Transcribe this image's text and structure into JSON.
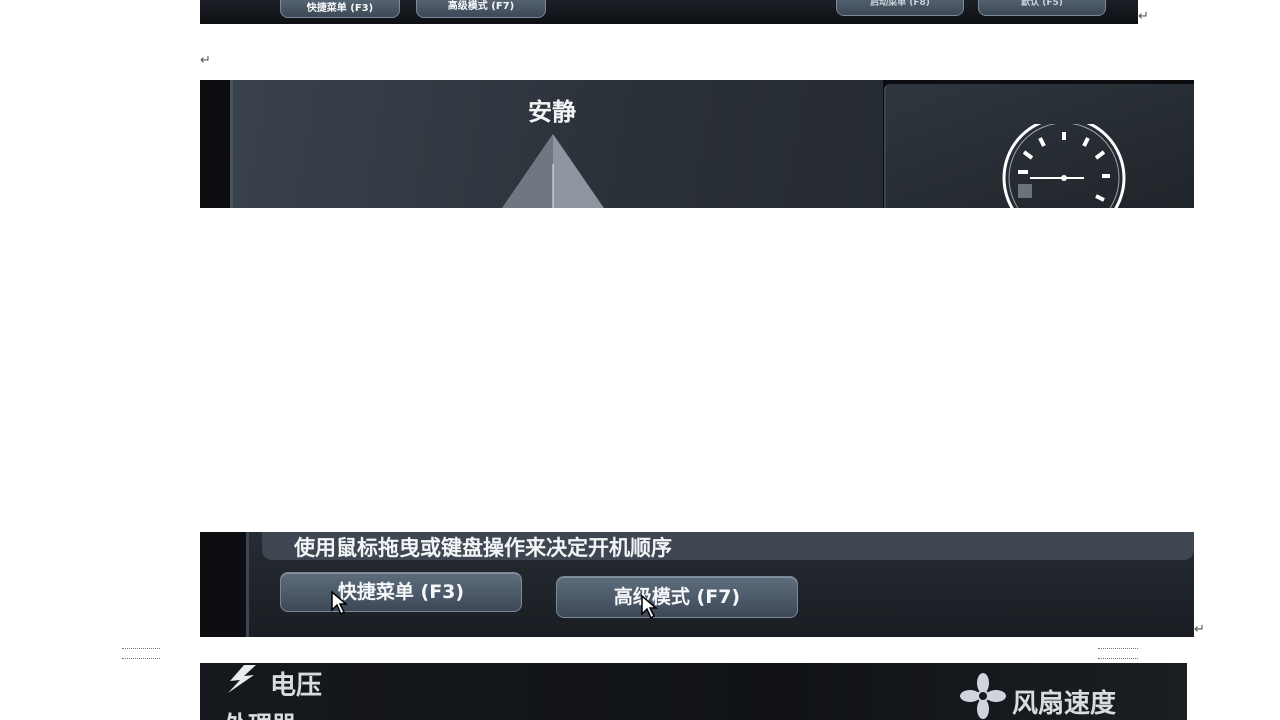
{
  "paragraph_mark": "↵",
  "image1": {
    "buttons": {
      "quick_menu": "快捷菜单 (F3)",
      "advanced_mode": "高级模式 (F7)",
      "right_a": "启动菜单 (F8)",
      "right_b": "默认 (F5)"
    }
  },
  "image2": {
    "mode_label": "安静"
  },
  "image3": {
    "instruction": "使用鼠标拖曳或键盘操作来决定开机顺序",
    "buttons": {
      "quick_menu": "快捷菜单 (F3)",
      "advanced_mode": "高级模式 (F7)"
    }
  },
  "image4": {
    "voltage_label": "电压",
    "processor_label": "处理器",
    "fan_speed_label": "风扇速度"
  },
  "colors": {
    "panel_dark": "#16191d",
    "button_fill": "#4d5a69",
    "text_light": "#f2f4f6"
  }
}
